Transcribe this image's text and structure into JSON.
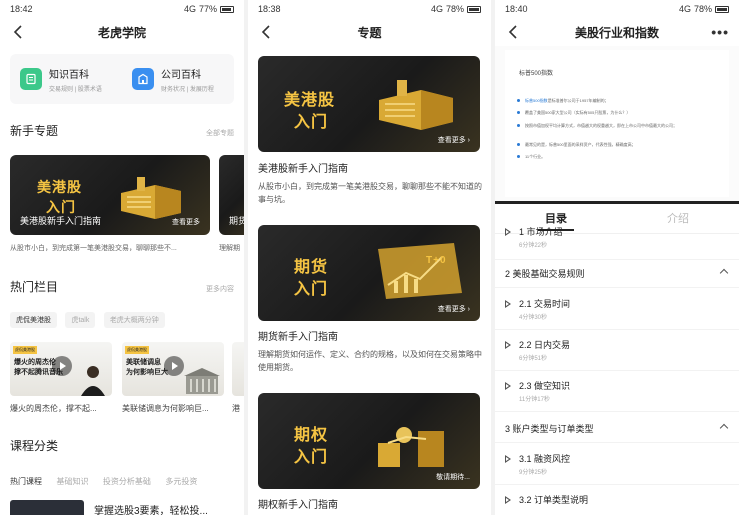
{
  "panel1": {
    "status": {
      "time": "18:42",
      "signal": "4G",
      "battery": "77%"
    },
    "nav": {
      "title": "老虎学院"
    },
    "wiki": [
      {
        "title": "知识百科",
        "sub": "交易规则 | 股票术语",
        "color": "#3cc88a"
      },
      {
        "title": "公司百科",
        "sub": "财务状况 | 发展历程",
        "color": "#3a8ff0"
      }
    ],
    "newbie": {
      "title": "新手专题",
      "more": "全部专题"
    },
    "banner": {
      "big_line1": "美港股",
      "big_line2": "入门",
      "caption": "美港股新手入门指南",
      "seemore": "查看更多",
      "peek": "期货"
    },
    "banner_desc": "从股市小白，到完成第一笔美港股交易，聊聊那些不...",
    "banner_desc2": "理解期",
    "hot": {
      "title": "热门栏目",
      "more": "更多内容"
    },
    "chips": [
      "虎侃美港股",
      "虎talk",
      "老虎大概两分钟"
    ],
    "thumbs": [
      {
        "tag": "虎侃美港股",
        "headline_l1": "爆火的周杰伦",
        "headline_l2": "撑不起腾讯音乐",
        "caption": "爆火的周杰伦，撑不起..."
      },
      {
        "tag": "虎侃美港股",
        "headline_l1": "美联储调息",
        "headline_l2": "为何影响巨大",
        "caption": "美联储调息为何影响巨..."
      },
      {
        "caption": "港"
      }
    ],
    "category": {
      "title": "课程分类"
    },
    "cat_tabs": [
      "热门课程",
      "基础知识",
      "投资分析基础",
      "多元投资"
    ],
    "course_peek": "掌握选股3要素，轻松投..."
  },
  "panel2": {
    "status": {
      "time": "18:38",
      "signal": "4G",
      "battery": "78%"
    },
    "nav": {
      "title": "专题"
    },
    "items": [
      {
        "big_line1": "美港股",
        "big_line2": "入门",
        "seemore": "查看更多",
        "title": "美港股新手入门指南",
        "desc": "从股市小白，到完成第一笔美港股交易，聊聊那些不能不知道的事与坑。"
      },
      {
        "big_line1": "期货",
        "big_line2": "入门",
        "seemore": "查看更多",
        "title": "期货新手入门指南",
        "desc": "理解期货如何运作、定义、合约的规格，以及如何在交易策略中使用期货。",
        "tplus": "T+0"
      },
      {
        "big_line1": "期权",
        "big_line2": "入门",
        "seemore": "敬请期待...",
        "title": "期权新手入门指南"
      }
    ]
  },
  "panel3": {
    "status": {
      "time": "18:40",
      "signal": "4G",
      "battery": "78%"
    },
    "nav": {
      "title": "美股行业和指数",
      "more": "•••"
    },
    "doc": {
      "title": "标普500指数",
      "lines": [
        {
          "hl": "标普500指数",
          "rest": "是标准普尔公司于1957年编制的；"
        },
        {
          "hl": "",
          "rest": "覆盖了美国500家大型公司（实际有505只股票，为什么？）"
        },
        {
          "hl": "",
          "rest": "按照市值加权平均计算方式，市值越大的权重越大，即在上市公司中市值最大的公司；"
        },
        {
          "hl": "",
          "rest": "最常见的是，标普500里面的采样资产，代表性强，精确度高；"
        },
        {
          "hl": "",
          "rest": "11个行业。"
        }
      ]
    },
    "tabs": [
      "目录",
      "介绍"
    ],
    "toc": [
      {
        "kind": "item",
        "name": "1 市场介绍",
        "dur": "6分钟22秒"
      },
      {
        "kind": "chapter",
        "name": "2 美股基础交易规则"
      },
      {
        "kind": "item",
        "name": "2.1 交易时间",
        "dur": "4分钟30秒"
      },
      {
        "kind": "item",
        "name": "2.2 日内交易",
        "dur": "6分钟51秒"
      },
      {
        "kind": "item",
        "name": "2.3 做空知识",
        "dur": "11分钟17秒"
      },
      {
        "kind": "chapter",
        "name": "3 账户类型与订单类型"
      },
      {
        "kind": "item",
        "name": "3.1 融资风控",
        "dur": "9分钟25秒"
      },
      {
        "kind": "item",
        "name": "3.2 订单类型说明",
        "dur": ""
      }
    ]
  },
  "colors": {
    "gold": "#f5c443",
    "dark_banner": "#222222",
    "link_blue": "#2a7bd5"
  }
}
